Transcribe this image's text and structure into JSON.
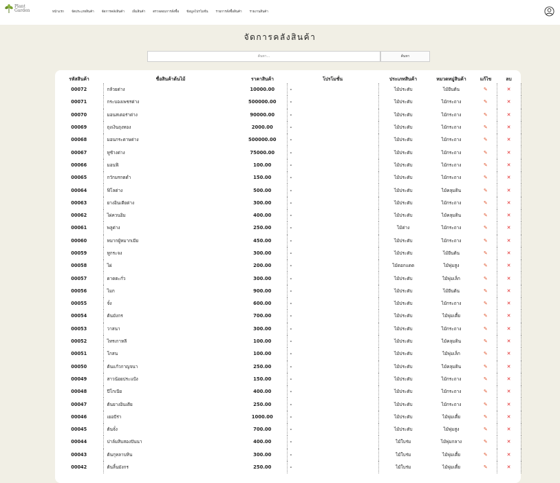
{
  "brand": {
    "line1": "Plant",
    "line2": "Garden",
    "leaf_color": "#6b8f2e"
  },
  "nav": {
    "items": [
      "หน้าแรก",
      "จัดประเภทสินค้า",
      "จัดการคลังสินค้า",
      "เพิ่มสินค้า",
      "ตรวจสอบการสั่งซื้อ",
      "ข้อมูลโปรโมชั่น",
      "รายการสั่งซื้อสินค้า",
      "รายงานสินค้า"
    ]
  },
  "page": {
    "title": "จัดการคลังสินค้า"
  },
  "search": {
    "placeholder": "ค้นหา...",
    "button": "ค้นหา"
  },
  "table": {
    "headers": [
      "รหัสสินค้า",
      "ชื่อสินค้าต้นไม้",
      "ราคาสินค้า",
      "โปรโมชั่น",
      "ประเภทสินค้า",
      "หมวดหมู่สินค้า",
      "แก้ไข",
      "ลบ"
    ],
    "rows": [
      {
        "id": "00072",
        "name": "กล้วยด่าง",
        "price": "10000.00",
        "promo": "-",
        "type": "ไม้ประดับ",
        "cat": "ไม้ยืนต้น"
      },
      {
        "id": "00071",
        "name": "กระบองเพชรด่าง",
        "price": "500000.00",
        "promo": "-",
        "type": "ไม้ประดับ",
        "cat": "ไม้กระถาง"
      },
      {
        "id": "00070",
        "name": "มอนสเตอร่าด่าง",
        "price": "90000.00",
        "promo": "-",
        "type": "ไม้ประดับ",
        "cat": "ไม้กระถาง"
      },
      {
        "id": "00069",
        "name": "ถุงเงินถุงทอง",
        "price": "2000.00",
        "promo": "-",
        "type": "ไม้ประดับ",
        "cat": "ไม้กระถาง"
      },
      {
        "id": "00068",
        "name": "มอนกระดาษด่าง",
        "price": "500000.00",
        "promo": "-",
        "type": "ไม้ประดับ",
        "cat": "ไม้กระถาง"
      },
      {
        "id": "00067",
        "name": "หูช้างด่าง",
        "price": "75000.00",
        "promo": "-",
        "type": "ไม้ประดับ",
        "cat": "ไม้กระถาง"
      },
      {
        "id": "00066",
        "name": "มอนฟิ",
        "price": "100.00",
        "promo": "-",
        "type": "ไม้ประดับ",
        "cat": "ไม้กระถาง"
      },
      {
        "id": "00065",
        "name": "กวักมรกตดำ",
        "price": "150.00",
        "promo": "-",
        "type": "ไม้ประดับ",
        "cat": "ไม้กระถาง"
      },
      {
        "id": "00064",
        "name": "ฟิโลด่าง",
        "price": "500.00",
        "promo": "-",
        "type": "ไม้ประดับ",
        "cat": "ไม้คลุมดิน"
      },
      {
        "id": "00063",
        "name": "ยางอินเดียด่าง",
        "price": "300.00",
        "promo": "-",
        "type": "ไม้ประดับ",
        "cat": "ไม้กระถาง"
      },
      {
        "id": "00062",
        "name": "ไผ่ควนอิม",
        "price": "400.00",
        "promo": "-",
        "type": "ไม้ประดับ",
        "cat": "ไม้คลุมดิน"
      },
      {
        "id": "00061",
        "name": "พลูด่าง",
        "price": "250.00",
        "promo": "-",
        "type": "ไม้ด่าง",
        "cat": "ไม้กระถาง"
      },
      {
        "id": "00060",
        "name": "หมากผู้หมากเมีย",
        "price": "450.00",
        "promo": "-",
        "type": "ไม้ประดับ",
        "cat": "ไม้กระถาง"
      },
      {
        "id": "00059",
        "name": "หูกระจง",
        "price": "300.00",
        "promo": "-",
        "type": "ไม้ประดับ",
        "cat": "ไม้ยืนต้น"
      },
      {
        "id": "00058",
        "name": "ไผ่",
        "price": "200.00",
        "promo": "-",
        "type": "ไม้ดอกแดด",
        "cat": "ไม้พุ่มสูง"
      },
      {
        "id": "00057",
        "name": "ดาดตะกั่ว",
        "price": "300.00",
        "promo": "-",
        "type": "ไม้ประดับ",
        "cat": "ไม้พุ่มเล็ก"
      },
      {
        "id": "00056",
        "name": "ไมก",
        "price": "900.00",
        "promo": "-",
        "type": "ไม้ประดับ",
        "cat": "ไม้ยืนต้น"
      },
      {
        "id": "00055",
        "name": "จั๋ง",
        "price": "600.00",
        "promo": "-",
        "type": "ไม้ประดับ",
        "cat": "ไม้กระถาง"
      },
      {
        "id": "00054",
        "name": "ต้นมังกร",
        "price": "700.00",
        "promo": "-",
        "type": "ไม้ประดับ",
        "cat": "ไม้พุ่มเตี้ย"
      },
      {
        "id": "00053",
        "name": "วาสนา",
        "price": "300.00",
        "promo": "-",
        "type": "ไม้ประดับ",
        "cat": "ไม้กระถาง"
      },
      {
        "id": "00052",
        "name": "ไทรเกาหลี",
        "price": "100.00",
        "promo": "-",
        "type": "ไม้ประดับ",
        "cat": "ไม้คลุมดิน"
      },
      {
        "id": "00051",
        "name": "โกสน",
        "price": "100.00",
        "promo": "-",
        "type": "ไม้ประดับ",
        "cat": "ไม้พุ่มเล็ก"
      },
      {
        "id": "00050",
        "name": "ต้นแก้วกาญจนา",
        "price": "250.00",
        "promo": "-",
        "type": "ไม้ประดับ",
        "cat": "ไม้คลุมดิน"
      },
      {
        "id": "00049",
        "name": "สาวน้อยประแป้ง",
        "price": "150.00",
        "promo": "-",
        "type": "ไม้ประดับ",
        "cat": "ไม้กระถาง"
      },
      {
        "id": "00048",
        "name": "ปีโกเนีย",
        "price": "400.00",
        "promo": "-",
        "type": "ไม้ประดับ",
        "cat": "ไม้กระถาง"
      },
      {
        "id": "00047",
        "name": "ต้นยางอินเดีย",
        "price": "250.00",
        "promo": "-",
        "type": "ไม้ประดับ",
        "cat": "ไม้กระถาง"
      },
      {
        "id": "00046",
        "name": "เยอบีร่า",
        "price": "1000.00",
        "promo": "-",
        "type": "ไม้ประดับ",
        "cat": "ไม้พุ่มเตี้ย"
      },
      {
        "id": "00045",
        "name": "ต้นจั๋ง",
        "price": "700.00",
        "promo": "-",
        "type": "ไม้ประดับ",
        "cat": "ไม้พุ่มสูง"
      },
      {
        "id": "00044",
        "name": "ปาล์มสิบสองปันนา",
        "price": "400.00",
        "promo": "-",
        "type": "ไม้ใบร่ม",
        "cat": "ไม้พุ่มกลาง"
      },
      {
        "id": "00043",
        "name": "ต้นกุหลาบหิน",
        "price": "300.00",
        "promo": "-",
        "type": "ไม้ใบร่ม",
        "cat": "ไม้พุ่มเตี้ย"
      },
      {
        "id": "00042",
        "name": "ต้นลิ้นมังกร",
        "price": "250.00",
        "promo": "-",
        "type": "ไม้ใบร่ม",
        "cat": "ไม้พุ่มเตี้ย"
      }
    ]
  },
  "colors": {
    "edit_icon": "#e0532b",
    "delete_icon": "#e02020"
  },
  "icons": {
    "edit": "pencil-icon",
    "delete": "close-icon",
    "user": "user-circle-icon"
  }
}
